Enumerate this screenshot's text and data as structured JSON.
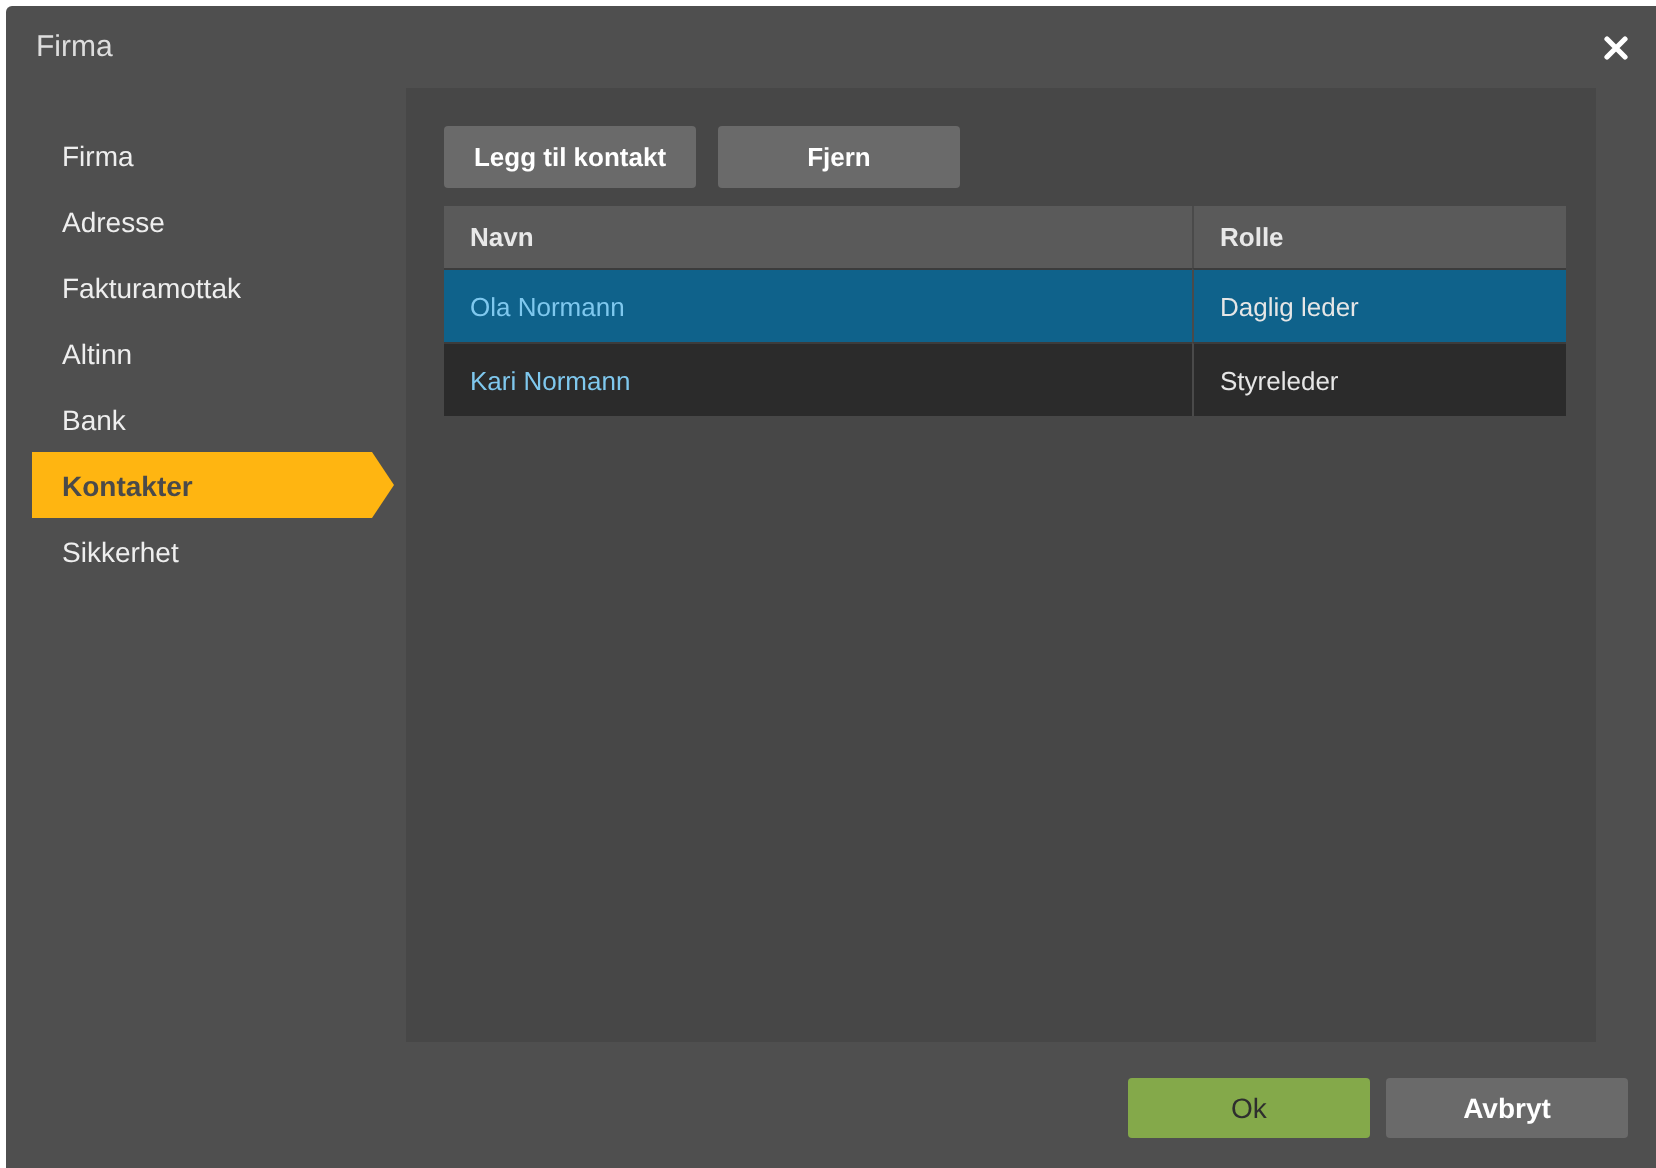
{
  "window": {
    "title": "Firma"
  },
  "sidebar": {
    "items": [
      {
        "label": "Firma",
        "selected": false
      },
      {
        "label": "Adresse",
        "selected": false
      },
      {
        "label": "Fakturamottak",
        "selected": false
      },
      {
        "label": "Altinn",
        "selected": false
      },
      {
        "label": "Bank",
        "selected": false
      },
      {
        "label": "Kontakter",
        "selected": true
      },
      {
        "label": "Sikkerhet",
        "selected": false
      }
    ]
  },
  "toolbar": {
    "buttons": [
      "Legg til kontakt",
      "Fjern"
    ]
  },
  "table": {
    "columns": [
      "Navn",
      "Rolle"
    ],
    "rows": [
      {
        "cells": [
          "Ola Normann",
          "Daglig leder"
        ],
        "selected": true
      },
      {
        "cells": [
          "Kari Normann",
          "Styreleder"
        ],
        "selected": false
      }
    ]
  },
  "footer": {
    "buttons": [
      {
        "label": "Ok",
        "kind": "primary"
      },
      {
        "label": "Avbryt",
        "kind": "secondary"
      }
    ]
  }
}
